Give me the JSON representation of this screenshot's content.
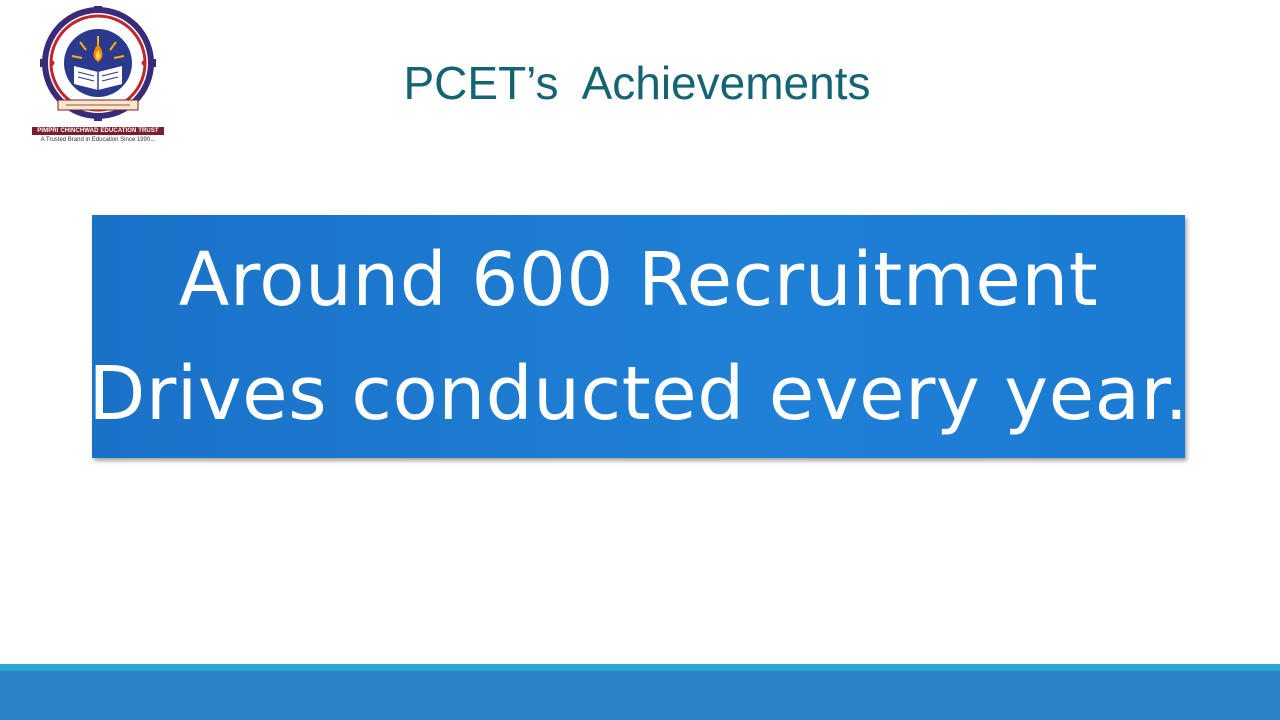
{
  "logo": {
    "org_name": "PIMPRI CHINCHWAD EDUCATION TRUST",
    "tagline": "A Trusted Brand in Education Since 1990..."
  },
  "title": "PCET’s  Achievements",
  "callout": {
    "line1": "Around 600 Recruitment",
    "line2": "Drives conducted every year."
  },
  "colors": {
    "title": "#156473",
    "callout_bg": "#1f80d6",
    "footer_accent": "#2aa6d6",
    "footer_bar": "#2b83c6"
  }
}
